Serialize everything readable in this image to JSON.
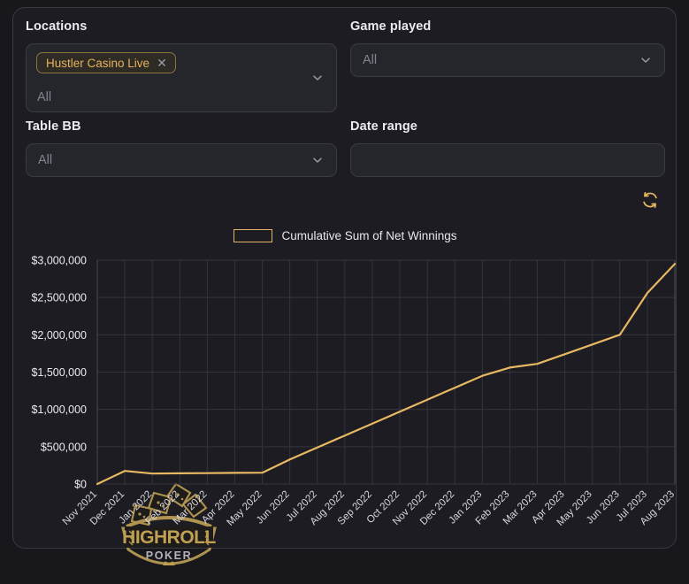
{
  "filters": {
    "locations": {
      "label": "Locations",
      "chip": "Hustler Casino Live",
      "chip_remove_icon": "close-x-icon",
      "placeholder": "All",
      "chevron_icon": "chevron-down-icon"
    },
    "game_played": {
      "label": "Game played",
      "value": "",
      "placeholder": "All",
      "chevron_icon": "chevron-down-icon"
    },
    "table_bb": {
      "label": "Table BB",
      "value": "",
      "placeholder": "All",
      "chevron_icon": "chevron-down-icon"
    },
    "date_range": {
      "label": "Date range",
      "value": "",
      "placeholder": ""
    },
    "refresh": {
      "icon": "refresh-icon",
      "label": "Refresh"
    }
  },
  "colors": {
    "accent_gold": "#e8b863",
    "chip_text": "#e7b25d",
    "page_background": "#17171c",
    "card_background": "#1c1c22",
    "control_background": "#25252c",
    "grid": "#34343d"
  },
  "watermark": {
    "brand_top": "HIGHROLL",
    "brand_bottom": "POKER",
    "icon": "highroll-poker-shield-logo"
  },
  "chart_data": {
    "type": "line",
    "title": "",
    "legend": [
      "Cumulative Sum of Net Winnings"
    ],
    "legend_position": "top-center",
    "xlabel": "",
    "ylabel": "",
    "grid": true,
    "ylim": [
      0,
      3000000
    ],
    "ytick_labels": [
      "$3,000,000",
      "$2,500,000",
      "$2,000,000",
      "$1,500,000",
      "$1,000,000",
      "$500,000",
      "$0"
    ],
    "ytick_values": [
      3000000,
      2500000,
      2000000,
      1500000,
      1000000,
      500000,
      0
    ],
    "categories": [
      "Nov 2021",
      "Dec 2021",
      "Jan 2022",
      "Feb 2022",
      "Mar 2022",
      "Apr 2022",
      "May 2022",
      "Jun 2022",
      "Jul 2022",
      "Aug 2022",
      "Sep 2022",
      "Oct 2022",
      "Nov 2022",
      "Dec 2022",
      "Jan 2023",
      "Feb 2023",
      "Mar 2023",
      "Apr 2023",
      "May 2023",
      "Jun 2023",
      "Jul 2023",
      "Aug 2023"
    ],
    "series": [
      {
        "name": "Cumulative Sum of Net Winnings",
        "color": "#e8b863",
        "values": [
          0,
          175000,
          140000,
          143000,
          146000,
          149000,
          152000,
          330000,
          490000,
          650000,
          810000,
          970000,
          1130000,
          1290000,
          1450000,
          1560000,
          1610000,
          1740000,
          1870000,
          2000000,
          2560000,
          2950000
        ]
      }
    ]
  }
}
